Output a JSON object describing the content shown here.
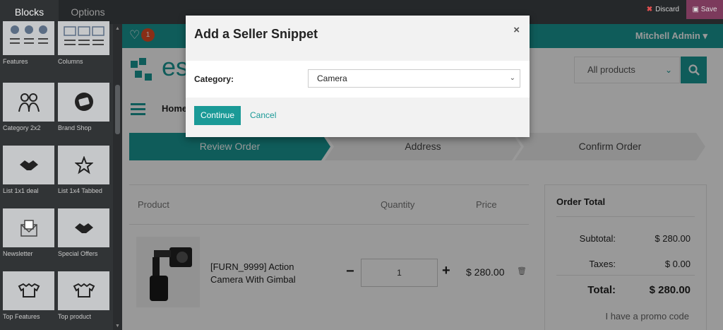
{
  "editor": {
    "tabs": [
      "Blocks",
      "Options"
    ],
    "discard_label": "Discard",
    "save_label": "Save",
    "blocks": [
      {
        "label": "Features",
        "icon": "features-icon"
      },
      {
        "label": "Columns",
        "icon": "columns-icon"
      },
      {
        "label": "Category 2x2",
        "icon": "people-icon"
      },
      {
        "label": "Brand Shop",
        "icon": "tag-icon"
      },
      {
        "label": "List 1x1 deal",
        "icon": "handshake-icon"
      },
      {
        "label": "List 1x4 Tabbed",
        "icon": "star-icon"
      },
      {
        "label": "Newsletter",
        "icon": "envelope-icon"
      },
      {
        "label": "Special Offers",
        "icon": "handshake-icon"
      },
      {
        "label": "Top Features",
        "icon": "shirts-icon"
      },
      {
        "label": "Top product",
        "icon": "shirts-icon"
      }
    ]
  },
  "site": {
    "wishlist_count": "1",
    "user_name": "Mitchell Admin",
    "logo_text": "es",
    "search_category": "All products",
    "nav_home": "Home",
    "steps": [
      "Review Order",
      "Address",
      "Confirm Order"
    ],
    "cart": {
      "headers": {
        "product": "Product",
        "quantity": "Quantity",
        "price": "Price"
      },
      "item": {
        "name": "[FURN_9999] Action Camera With Gimbal",
        "quantity": "1",
        "price": "$ 280.00"
      }
    },
    "order_total": {
      "title": "Order Total",
      "subtotal_label": "Subtotal:",
      "subtotal": "$ 280.00",
      "taxes_label": "Taxes:",
      "taxes": "$ 0.00",
      "total_label": "Total:",
      "total": "$ 280.00",
      "promo": "I have a promo code"
    }
  },
  "modal": {
    "title": "Add a Seller Snippet",
    "close": "×",
    "category_label": "Category:",
    "category_value": "Camera",
    "continue_label": "Continue",
    "cancel_label": "Cancel"
  },
  "colors": {
    "accent": "#1a9a97",
    "badge": "#e44d26",
    "save_bg": "#7c3a5c"
  }
}
